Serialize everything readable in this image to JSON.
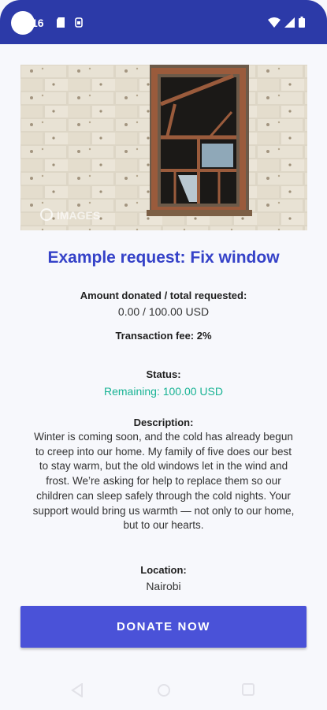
{
  "status_bar": {
    "time": "16",
    "icons": [
      "sd-card-icon",
      "sim-icon",
      "wifi-icon",
      "signal-icon",
      "battery-icon"
    ]
  },
  "hero_image": {
    "subject": "old broken window frame in a white stone wall",
    "watermark": "IMAGES"
  },
  "request": {
    "title": "Example request: Fix window",
    "amount_label": "Amount donated / total requested:",
    "amount_value": "0.00 / 100.00 USD",
    "fee_text": "Transaction fee: 2%",
    "status_label": "Status:",
    "status_value": "Remaining: 100.00 USD",
    "description_label": "Description:",
    "description_text": "Winter is coming soon, and the cold has already begun to creep into our home. My family of five does our best to stay warm, but the old windows let in the wind and frost. We’re asking for help to replace them so our children can sleep safely through the cold nights. Your support would bring us warmth — not only to our home, but to our hearts.",
    "location_label": "Location:",
    "location_value": "Nairobi"
  },
  "actions": {
    "donate_label": "DONATE NOW"
  },
  "navigation": {
    "items": [
      "back-icon",
      "home-icon",
      "recents-icon"
    ]
  },
  "colors": {
    "status_bar": "#2c3aa8",
    "title": "#3542c8",
    "remaining": "#19b394",
    "button": "#4a52d8",
    "background": "#f7f8fc"
  }
}
